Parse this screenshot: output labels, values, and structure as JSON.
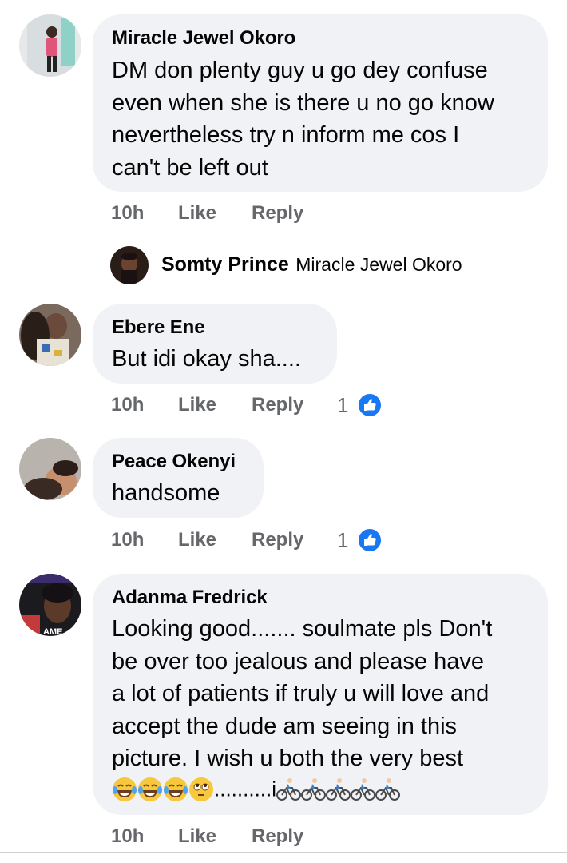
{
  "comments": [
    {
      "author": "Miracle Jewel Okoro",
      "lines": [
        "DM don plenty guy u go dey confuse",
        "even when she is there u no go know",
        "nevertheless try n inform me cos I",
        "can't be left out"
      ],
      "time": "10h",
      "like": "Like",
      "reply": "Reply",
      "avatar_icon": "profile-photo-avatar"
    },
    {
      "author": "Ebere Ene",
      "lines": [
        "But idi okay sha...."
      ],
      "time": "10h",
      "like": "Like",
      "reply": "Reply",
      "reactions": "1",
      "avatar_icon": "profile-photo-avatar"
    },
    {
      "author": "Peace Okenyi",
      "lines": [
        "handsome"
      ],
      "time": "10h",
      "like": "Like",
      "reply": "Reply",
      "reactions": "1",
      "avatar_icon": "profile-photo-avatar"
    },
    {
      "author": "Adanma Fredrick",
      "lines": [
        "Looking good....... soulmate  pls Don't",
        "be over too jealous and please have",
        "a lot of patients if truly u will love and",
        "accept the dude am seeing in this",
        "picture. I wish u both the very best"
      ],
      "emoji_dots": "..........",
      "emoji_i": "i",
      "avatar_text": "AME",
      "time": "10h",
      "like": "Like",
      "reply": "Reply",
      "avatar_icon": "profile-photo-avatar"
    }
  ],
  "reply_preview": {
    "author": "Somty Prince",
    "text": "Miracle Jewel Okoro"
  },
  "colors": {
    "bubble": "#f0f2f5",
    "meta": "#65676b",
    "like_blue": "#1877f2"
  },
  "icons": {
    "like_badge": "thumbs-up-icon",
    "emoji_laugh": "face-with-tears-of-joy-icon",
    "emoji_eyeroll": "face-with-rolling-eyes-icon",
    "emoji_cyclist": "person-biking-icon"
  }
}
